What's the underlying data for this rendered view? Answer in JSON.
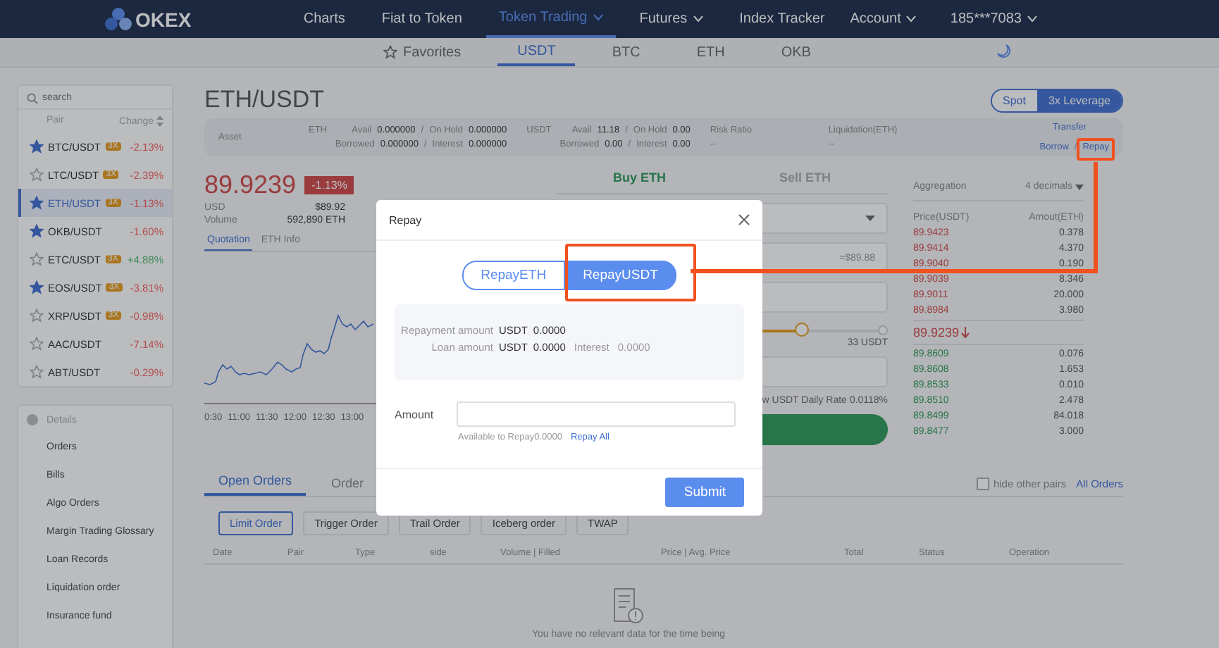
{
  "nav": {
    "logo": "OKEX",
    "items": [
      {
        "label": "Charts",
        "selected": false,
        "caret": false
      },
      {
        "label": "Fiat to Token",
        "selected": false,
        "caret": false
      },
      {
        "label": "Token Trading",
        "selected": true,
        "caret": true
      },
      {
        "label": "Futures",
        "selected": false,
        "caret": true
      },
      {
        "label": "Index Tracker",
        "selected": false,
        "caret": false
      }
    ],
    "account": "Account",
    "user": "185***7083"
  },
  "market_tabs": [
    {
      "label": "Favorites",
      "selected": false,
      "star": true
    },
    {
      "label": "USDT",
      "selected": true,
      "star": false
    },
    {
      "label": "BTC",
      "selected": false,
      "star": false
    },
    {
      "label": "ETH",
      "selected": false,
      "star": false
    },
    {
      "label": "OKB",
      "selected": false,
      "star": false
    }
  ],
  "sidebar": {
    "search": {
      "placeholder": "search"
    },
    "col_pair": "Pair",
    "col_change": "Change",
    "pairs": [
      {
        "pair": "BTC/USDT",
        "badge": "3X",
        "change": "-2.13%",
        "color": "#b54d4d",
        "favorite": true,
        "selected": false
      },
      {
        "pair": "LTC/USDT",
        "badge": "3X",
        "change": "-2.39%",
        "color": "#b54d4d",
        "favorite": false,
        "selected": false
      },
      {
        "pair": "ETH/USDT",
        "badge": "3X",
        "change": "-1.13%",
        "color": "#b54d4d",
        "favorite": true,
        "selected": true
      },
      {
        "pair": "OKB/USDT",
        "change": "-1.60%",
        "color": "#b54d4d",
        "favorite": true,
        "selected": false
      },
      {
        "pair": "ETC/USDT",
        "badge": "3X",
        "change": "+4.88%",
        "color": "#3f8a5a",
        "favorite": false,
        "selected": false
      },
      {
        "pair": "EOS/USDT",
        "badge": "3X",
        "change": "-3.81%",
        "color": "#b54d4d",
        "favorite": true,
        "selected": false
      },
      {
        "pair": "XRP/USDT",
        "badge": "3X",
        "change": "-0.98%",
        "color": "#b54d4d",
        "favorite": false,
        "selected": false
      },
      {
        "pair": "AAC/USDT",
        "change": "-7.14%",
        "color": "#b54d4d",
        "favorite": false,
        "selected": false
      },
      {
        "pair": "ABT/USDT",
        "change": "-0.29%",
        "color": "#b54d4d",
        "favorite": false,
        "selected": false
      }
    ],
    "details_title": "Details",
    "details": [
      "Orders",
      "Bills",
      "Algo Orders",
      "Margin Trading Glossary",
      "Loan Records",
      "Liquidation order",
      "Insurance fund"
    ]
  },
  "title": "ETH/USDT",
  "mode_toggle": [
    {
      "label": "Spot",
      "selected": false
    },
    {
      "label": "3x Leverage",
      "selected": true
    }
  ],
  "asset": {
    "label": "Asset",
    "groups": [
      {
        "coin": "ETH",
        "avail_label": "Avail",
        "avail": "0.000000",
        "hold_label": "On Hold",
        "hold": "0.000000",
        "borrowed_label": "Borrowed",
        "borrowed": "0.000000",
        "interest_label": "Interest",
        "interest": "0.000000"
      },
      {
        "coin": "USDT",
        "avail_label": "Avail",
        "avail": "11.18",
        "hold_label": "On Hold",
        "hold": "0.00",
        "borrowed_label": "Borrowed",
        "borrowed": "0.00",
        "interest_label": "Interest",
        "interest": "0.00"
      }
    ],
    "risk_label": "Risk Ratio",
    "risk": "--",
    "liq_label": "Liquidation(ETH)",
    "liq": "--",
    "transfer": "Transfer",
    "borrow": "Borrow",
    "sep": "/",
    "repay": "Repay"
  },
  "quote": {
    "price": "89.9239",
    "change": "-1.13%",
    "usd_label": "USD",
    "usd": "$89.92",
    "volume_label": "Volume",
    "volume": "592,890 ETH",
    "tabs": [
      {
        "label": "Quotation",
        "selected": true
      },
      {
        "label": "ETH Info",
        "selected": false
      }
    ],
    "xlabels": [
      "0:30",
      "11:00",
      "11:30",
      "12:00",
      "12:30",
      "13:00"
    ]
  },
  "trade": {
    "tabs": [
      {
        "label": "Buy ETH",
        "selected": true
      },
      {
        "label": "Sell ETH",
        "selected": false
      }
    ],
    "estimate": "≈$89.88",
    "slider": {
      "level": 0.75
    },
    "slider_reading": "33 USDT",
    "rate": "w USDT Daily Rate 0.0118%"
  },
  "orderbook": {
    "aggregation": "Aggregation",
    "decimals": "4 decimals",
    "col_price": "Price(USDT)",
    "col_amount": "Amout(ETH)",
    "asks": [
      [
        "89.9423",
        "0.378"
      ],
      [
        "89.9414",
        "4.370"
      ],
      [
        "89.9040",
        "0.190"
      ],
      [
        "89.9039",
        "8.346"
      ],
      [
        "89.9011",
        "20.000"
      ],
      [
        "89.8984",
        "3.980"
      ]
    ],
    "last": "89.9239",
    "bids": [
      [
        "89.8609",
        "0.076"
      ],
      [
        "89.8608",
        "1.653"
      ],
      [
        "89.8533",
        "0.010"
      ],
      [
        "89.8510",
        "2.478"
      ],
      [
        "89.8499",
        "84.018"
      ],
      [
        "89.8477",
        "3.000"
      ]
    ]
  },
  "orders": {
    "tabs": [
      {
        "label": "Open Orders",
        "selected": true
      },
      {
        "label": "Order",
        "selected": false
      }
    ],
    "hide_pairs": {
      "label": "hide other pairs",
      "checked": false
    },
    "all_orders": "All Orders",
    "types": [
      {
        "label": "Limit Order",
        "selected": true
      },
      {
        "label": "Trigger Order",
        "selected": false
      },
      {
        "label": "Trail Order",
        "selected": false
      },
      {
        "label": "Iceberg order",
        "selected": false
      },
      {
        "label": "TWAP",
        "selected": false
      }
    ],
    "columns": [
      "Date",
      "Pair",
      "Type",
      "side",
      "Volume | Filled",
      "Price | Avg. Price",
      "Total",
      "Status",
      "Operation"
    ],
    "empty": "You have no relevant data for the time being"
  },
  "modal": {
    "title": "Repay",
    "tabs": [
      {
        "label": "RepayETH",
        "selected": false
      },
      {
        "label": "RepayUSDT",
        "selected": true
      }
    ],
    "repay_label": "Repayment amount",
    "repay_coin": "USDT",
    "repay_value": "0.0000",
    "loan_label": "Loan amount",
    "loan_coin": "USDT",
    "loan_value": "0.0000",
    "interest_label": "Interest",
    "interest_value": "0.0000",
    "amount_label": "Amount",
    "available": "Available to Repay0.0000",
    "repay_all": "Repay All",
    "submit": "Submit"
  }
}
